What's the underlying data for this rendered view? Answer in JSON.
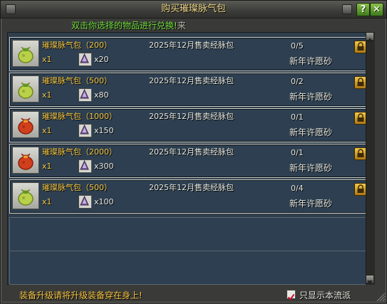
{
  "window": {
    "title": "购买璀璨脉气包",
    "help_label": "?",
    "close_label": "✕"
  },
  "hint": {
    "text": "双击你选择的物品进行兑换!",
    "tail": "来"
  },
  "items": [
    {
      "name": "璀璨脉气包（200）",
      "quantity": "x1",
      "cost": "x20",
      "source": "2025年12月售卖经脉包",
      "limit": "0/5",
      "currency": "新年许愿砂",
      "icon": "green-bag-icon"
    },
    {
      "name": "璀璨脉气包（500）",
      "quantity": "x1",
      "cost": "x80",
      "source": "2025年12月售卖经脉包",
      "limit": "0/2",
      "currency": "新年许愿砂",
      "icon": "green-bag-icon"
    },
    {
      "name": "璀璨脉气包（1000）",
      "quantity": "x1",
      "cost": "x150",
      "source": "2025年12月售卖经脉包",
      "limit": "0/1",
      "currency": "新年许愿砂",
      "icon": "red-bag-icon"
    },
    {
      "name": "璀璨脉气包（2000）",
      "quantity": "x1",
      "cost": "x300",
      "source": "2025年12月售卖经脉包",
      "limit": "0/1",
      "currency": "新年许愿砂",
      "icon": "red-bag-icon"
    },
    {
      "name": "璀璨脉气包（500）",
      "quantity": "x1",
      "cost": "x100",
      "source": "2025年12月售卖经脉包",
      "limit": "0/4",
      "currency": "新年许愿砂",
      "icon": "green-bag-icon"
    }
  ],
  "footer": {
    "hint": "装备升级请将升级装备穿在身上!",
    "checkbox_label": "只显示本流派",
    "checkbox_checked": true
  },
  "colors": {
    "name_text": "#f5c542",
    "hint_text": "#6dde3a",
    "panel_bg": "#2f3e4b"
  }
}
